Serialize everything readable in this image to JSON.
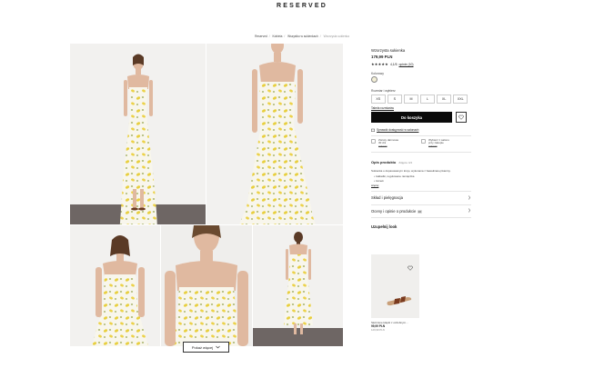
{
  "header": {
    "logo": "RESERVED"
  },
  "breadcrumb": [
    "Reserved",
    "Kobieta",
    "Wszystko w sukienkach",
    "Wzorzysta sukienka"
  ],
  "gallery": {
    "show_more_label": "Pokaż więcej"
  },
  "product": {
    "title": "Wzorzysta sukienka",
    "price": "179,99 PLN",
    "stars": "★★★★★",
    "rating_value": "4,1/5",
    "reviews_link": "opinie (10)",
    "color_label": "Kolorowy",
    "size_label": "Rozmiar i wybierz",
    "sizes": [
      "XS",
      "S",
      "M",
      "L",
      "XL",
      "XXL"
    ],
    "size_guide": "Tabela rozmiarów",
    "add_to_cart": "Do koszyka",
    "store_link": "Sprawdź dostępność w salonach",
    "returns": [
      {
        "title": "Zwroty darmowe",
        "line2": "30 dni",
        "line3": "zobacz"
      },
      {
        "title": "Wybierz z salonu",
        "line2": "przy zakupie",
        "line3": "zobacz"
      }
    ],
    "desc_title": "Opis produktu",
    "desc_sub": "Zdjęcie 4/4",
    "desc_text": "Sukienka o dopasowanym kroju, wykonana z bawełnianej tkaniny.",
    "desc_bullets": [
      "zakładki, regulowane ramiączka",
      "zamek"
    ],
    "desc_more": "więcej",
    "care_label": "Skład i pielęgnacja",
    "reviews_label": "Oceny i opinie o produkcie",
    "reviews_count": "10",
    "complete_look_label": "Uzupełnij look",
    "look_item": {
      "name": "Skórzane klapki z ozdobnym...",
      "price": "99,99 PLN",
      "old": "129,99 PLN"
    }
  },
  "colors": {
    "accent": "#0a0a0a",
    "lemon": "#e8cf3f",
    "leaf": "#8a9a3a",
    "dress": "#f8f6ec"
  }
}
